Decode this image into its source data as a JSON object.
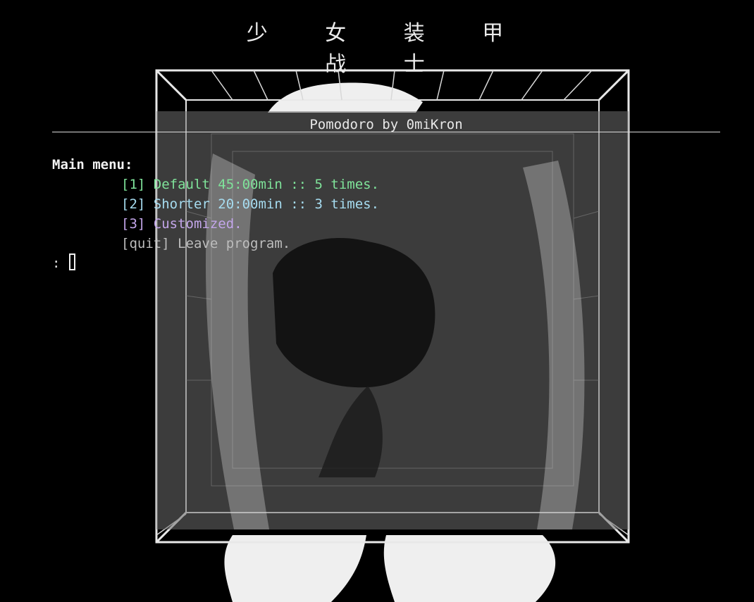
{
  "wallpaper": {
    "title": "少 女 装 甲 战 士"
  },
  "terminal": {
    "app_title": "Pomodoro by 0miKron",
    "menu_heading": "Main menu:",
    "options": [
      {
        "label": "[1] Default 45:00min :: 5 times.",
        "color": "#7fe39a"
      },
      {
        "label": "[2] Shorter 20:00min :: 3 times.",
        "color": "#a6dcf0"
      },
      {
        "label": "[3] Customized.",
        "color": "#c3a6ea"
      },
      {
        "label": "[quit] Leave program.",
        "color": "#bdbdbd"
      }
    ],
    "prompt": ":",
    "input_value": ""
  },
  "colors": {
    "background": "#000000",
    "panel": "#6e6e6e",
    "text": "#e6e6e6"
  }
}
